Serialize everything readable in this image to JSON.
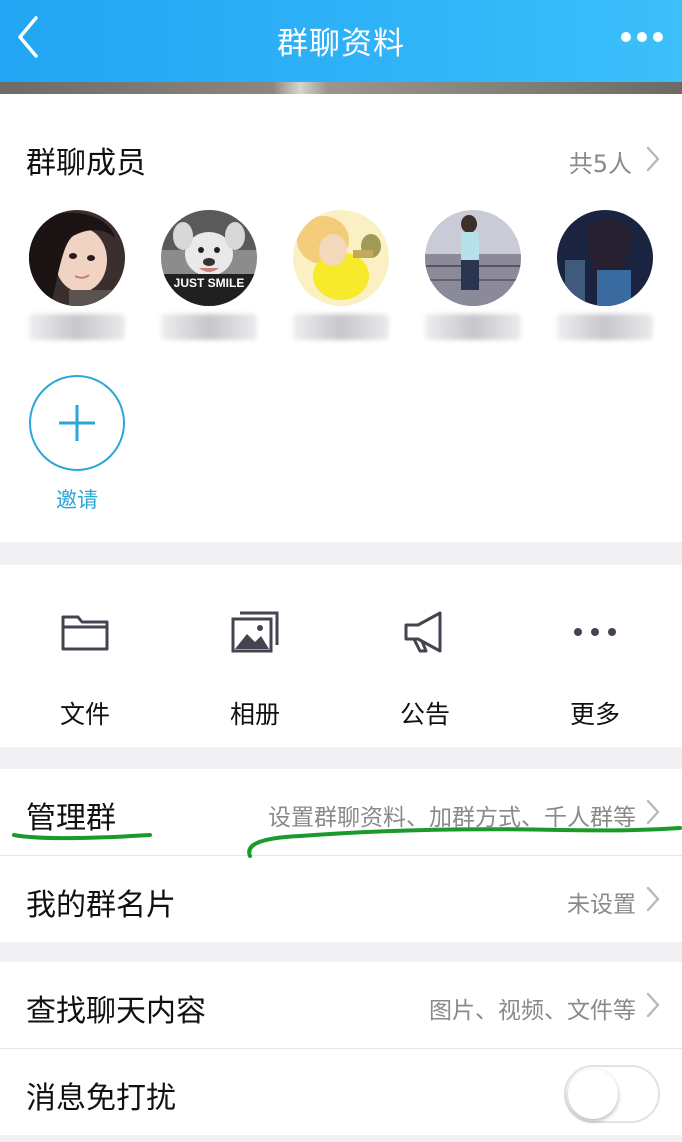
{
  "navbar": {
    "title": "群聊资料",
    "back_icon": "chevron-left-icon",
    "more_icon": "more-horizontal-icon"
  },
  "members": {
    "title": "群聊成员",
    "count_label": "共5人",
    "avatars": [
      {
        "name": "member-avatar-1",
        "caption": ""
      },
      {
        "name": "member-avatar-2",
        "caption": "JUST SMILE"
      },
      {
        "name": "member-avatar-3",
        "caption": ""
      },
      {
        "name": "member-avatar-4",
        "caption": ""
      },
      {
        "name": "member-avatar-5",
        "caption": ""
      }
    ],
    "invite_label": "邀请"
  },
  "actions": [
    {
      "label": "文件",
      "icon": "folder-icon"
    },
    {
      "label": "相册",
      "icon": "album-icon"
    },
    {
      "label": "公告",
      "icon": "megaphone-icon"
    },
    {
      "label": "更多",
      "icon": "more-horizontal-icon"
    }
  ],
  "settings": {
    "manage": {
      "label": "管理群",
      "value": "设置群聊资料、加群方式、千人群等"
    },
    "card": {
      "label": "我的群名片",
      "value": "未设置"
    },
    "search": {
      "label": "查找聊天内容",
      "value": "图片、视频、文件等"
    },
    "mute": {
      "label": "消息免打扰",
      "enabled": false
    }
  },
  "colors": {
    "nav_gradient_start": "#22a6f3",
    "nav_gradient_end": "#3cc0fb",
    "accent": "#2aa6d8",
    "annotation": "#1a9a2a",
    "secondary_text": "#8a8a8a"
  }
}
